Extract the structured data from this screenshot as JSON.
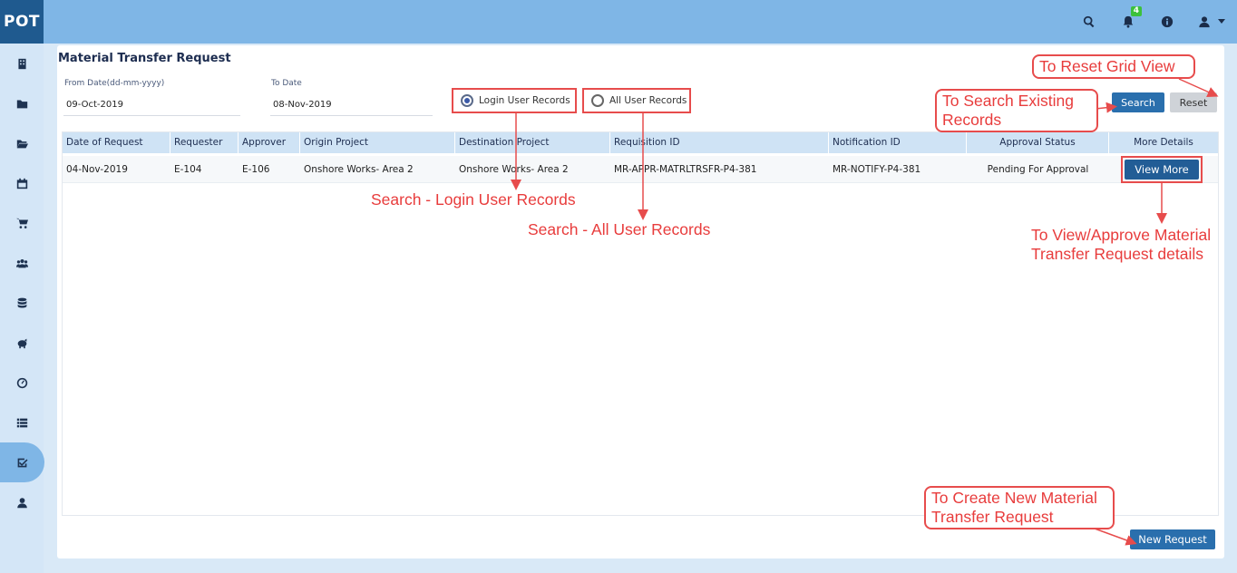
{
  "app": {
    "brand": "POT",
    "notification_count": "4"
  },
  "page": {
    "title": "Material Transfer Request"
  },
  "filters": {
    "from_label": "From Date(dd-mm-yyyy)",
    "from_value": "09-Oct-2019",
    "to_label": "To Date",
    "to_value": "08-Nov-2019",
    "radio_login": "Login User Records",
    "radio_all": "All User Records",
    "search_label": "Search",
    "reset_label": "Reset"
  },
  "table": {
    "headers": [
      "Date of Request",
      "Requester",
      "Approver",
      "Origin Project",
      "Destination Project",
      "Requisition ID",
      "Notification ID",
      "Approval Status",
      "More Details"
    ],
    "rows": [
      [
        "04-Nov-2019",
        "E-104",
        "E-106",
        "Onshore Works- Area 2",
        "Onshore Works- Area 2",
        "MR-APPR-MATRLTRSFR-P4-381",
        "MR-NOTIFY-P4-381",
        "Pending For Approval",
        "View More"
      ]
    ]
  },
  "footer": {
    "new_request_label": "New Request"
  },
  "annotations": {
    "reset": "To Reset Grid View",
    "search_line1": "To Search Existing",
    "search_line2": "Records",
    "login": "Search - Login User Records",
    "all": "Search - All User Records",
    "view_line1": "To View/Approve Material",
    "view_line2": "Transfer Request details",
    "new_line1": "To Create New Material",
    "new_line2": "Transfer Request"
  },
  "icons": {
    "top": [
      "search-icon",
      "bell-icon",
      "info-icon",
      "user-icon"
    ],
    "sidebar": [
      "building-icon",
      "folder-icon",
      "folder-open-icon",
      "calendar-icon",
      "cart-icon",
      "users-icon",
      "database-icon",
      "piggy-bank-icon",
      "dashboard-icon",
      "list-icon",
      "check-square-icon",
      "user-icon"
    ]
  },
  "colors": {
    "topbar": "#7fb6e6",
    "brand": "#1f5a8f",
    "annotation": "#e74c4c",
    "primary": "#2a6fad"
  }
}
